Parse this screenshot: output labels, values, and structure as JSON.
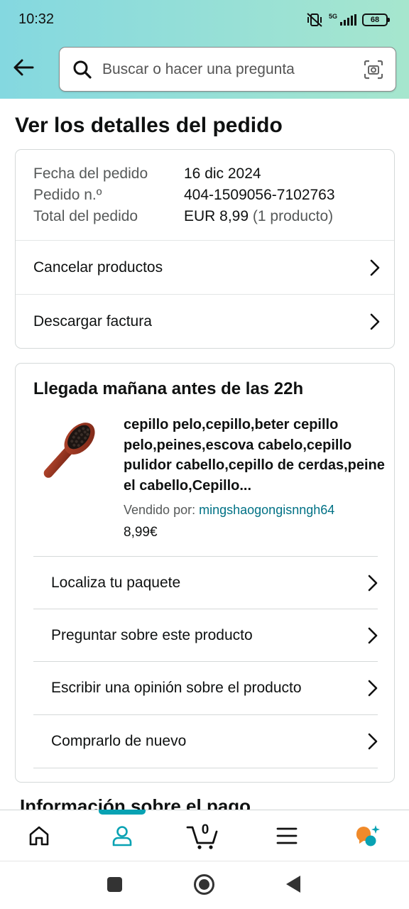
{
  "status_bar": {
    "time": "10:32",
    "network": "5G",
    "battery": "68",
    "icons": [
      "mute-vibrate-icon",
      "signal-icon",
      "battery-icon"
    ]
  },
  "header": {
    "back_icon": "arrow-left-icon",
    "search_placeholder": "Buscar o hacer una pregunta",
    "search_icon": "search-icon",
    "camera_icon": "camera-scan-icon"
  },
  "page": {
    "title": "Ver los detalles del pedido"
  },
  "order_summary": {
    "rows": [
      {
        "label": "Fecha del pedido",
        "value": "16 dic 2024"
      },
      {
        "label": "Pedido n.º",
        "value": "404-1509056-7102763"
      },
      {
        "label": "Total del pedido",
        "value": "EUR 8,99",
        "extra": "(1 producto)"
      }
    ],
    "actions": [
      "Cancelar productos",
      "Descargar factura"
    ]
  },
  "shipment": {
    "arrival": "Llegada mañana antes de las 22h",
    "product": {
      "title": "cepillo pelo,cepillo,beter cepillo pelo,peines,escova cabelo,cepillo pulidor cabello,cepillo de cerdas,peine el cabello,Cepillo...",
      "seller_label": "Vendido por:",
      "seller_name": "mingshaogongisnngh64",
      "price": "8,99€"
    },
    "actions": [
      "Localiza tu paquete",
      "Preguntar sobre este producto",
      "Escribir una opinión sobre el producto",
      "Comprarlo de nuevo"
    ]
  },
  "next_section": {
    "title": "Información sobre el pago"
  },
  "bottom_nav": {
    "items": [
      "home-icon",
      "account-icon",
      "cart-icon",
      "menu-icon",
      "rufus-assistant-icon"
    ],
    "active": "account-icon",
    "cart_count": "0"
  },
  "system_nav": {
    "items": [
      "recents-square-icon",
      "home-circle-icon",
      "back-triangle-icon"
    ]
  },
  "colors": {
    "header_gradient_start": "#84d8e0",
    "header_gradient_end": "#a6e6ce",
    "link": "#007185",
    "active_nav": "#08a2b3",
    "rufus_orange": "#f08a2a"
  }
}
